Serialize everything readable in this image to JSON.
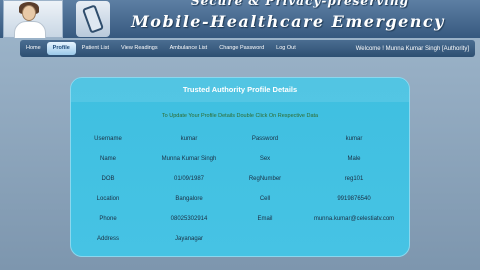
{
  "header": {
    "title_top": "Secure & Privacy-preserving",
    "title_main": "Mobile-Healthcare Emergency"
  },
  "nav": {
    "items": [
      {
        "label": "Home",
        "active": false
      },
      {
        "label": "Profile",
        "active": true
      },
      {
        "label": "Patient List",
        "active": false
      },
      {
        "label": "View Readings",
        "active": false
      },
      {
        "label": "Ambulance List",
        "active": false
      },
      {
        "label": "Change Password",
        "active": false
      },
      {
        "label": "Log Out",
        "active": false
      }
    ],
    "welcome": "Welcome ! Munna Kumar Singh [Authority]"
  },
  "card": {
    "title": "Trusted Authority Profile Details",
    "hint": "To Update Your Profile Details Double Click On Respective Data",
    "rows": [
      {
        "label1": "Username",
        "value1": "kumar",
        "label2": "Password",
        "value2": "kumar"
      },
      {
        "label1": "Name",
        "value1": "Munna Kumar Singh",
        "label2": "Sex",
        "value2": "Male"
      },
      {
        "label1": "DOB",
        "value1": "01/09/1987",
        "label2": "RegNumber",
        "value2": "reg101"
      },
      {
        "label1": "Location",
        "value1": "Bangalore",
        "label2": "Cell",
        "value2": "9919876540"
      },
      {
        "label1": "Phone",
        "value1": "08025302914",
        "label2": "Email",
        "value2": "munna.kumar@celestiatv.com"
      },
      {
        "label1": "Address",
        "value1": "Jayanagar",
        "label2": "",
        "value2": ""
      }
    ]
  },
  "colors": {
    "header_bg": "#36597f",
    "nav_bg": "#2e4f72",
    "card_bg": "#3fbfe0",
    "hint_text": "#2e6b2e"
  }
}
